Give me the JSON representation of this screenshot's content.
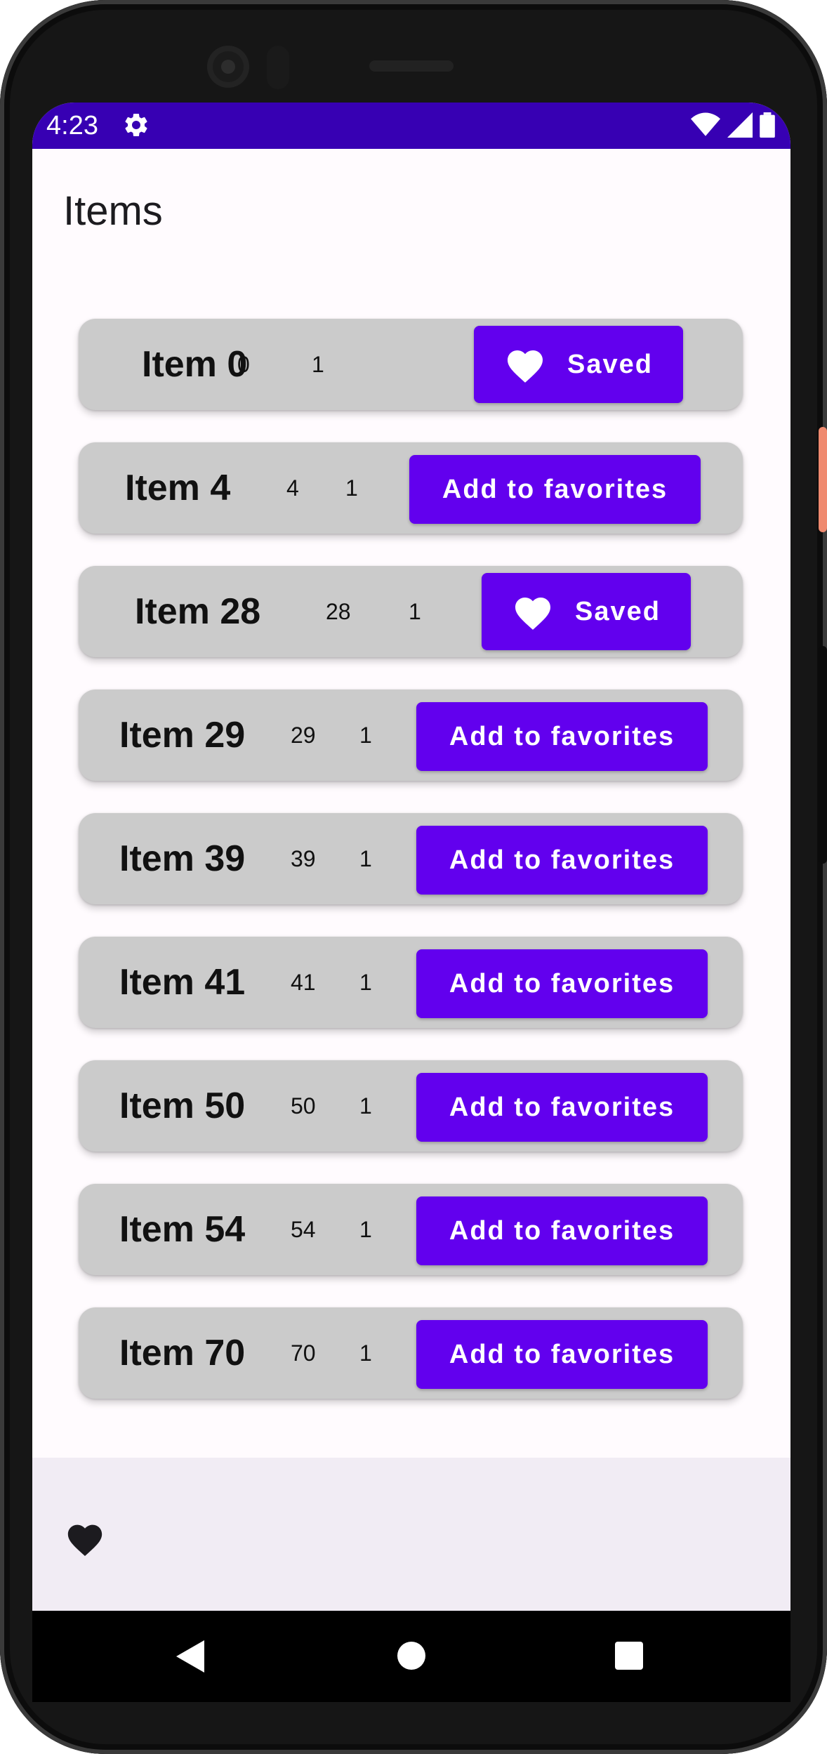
{
  "status_bar": {
    "time": "4:23",
    "gear_icon": "settings-gear-icon",
    "wifi_icon": "wifi-icon",
    "signal_icon": "cell-signal-icon",
    "battery_icon": "battery-icon"
  },
  "app": {
    "title": "Items"
  },
  "items": [
    {
      "name": "Item 0",
      "id_value": "0",
      "count": "1",
      "button_label": "Saved",
      "saved": true
    },
    {
      "name": "Item 4",
      "id_value": "4",
      "count": "1",
      "button_label": "Add to favorites",
      "saved": false
    },
    {
      "name": "Item 28",
      "id_value": "28",
      "count": "1",
      "button_label": "Saved",
      "saved": true
    },
    {
      "name": "Item 29",
      "id_value": "29",
      "count": "1",
      "button_label": "Add to favorites",
      "saved": false
    },
    {
      "name": "Item 39",
      "id_value": "39",
      "count": "1",
      "button_label": "Add to favorites",
      "saved": false
    },
    {
      "name": "Item 41",
      "id_value": "41",
      "count": "1",
      "button_label": "Add to favorites",
      "saved": false
    },
    {
      "name": "Item 50",
      "id_value": "50",
      "count": "1",
      "button_label": "Add to favorites",
      "saved": false
    },
    {
      "name": "Item 54",
      "id_value": "54",
      "count": "1",
      "button_label": "Add to favorites",
      "saved": false
    },
    {
      "name": "Item 70",
      "id_value": "70",
      "count": "1",
      "button_label": "Add to favorites",
      "saved": false
    }
  ],
  "bottom_bar": {
    "icon": "heart-icon"
  },
  "nav_bar": {
    "back_icon": "back-triangle-icon",
    "home_icon": "home-circle-icon",
    "recents_icon": "recents-square-icon"
  },
  "colors": {
    "status_bar": "#3700b3",
    "primary": "#6200ee",
    "card": "#cbcbcb",
    "background": "#fffbfe",
    "bottom_bar": "#f1ecf4"
  }
}
